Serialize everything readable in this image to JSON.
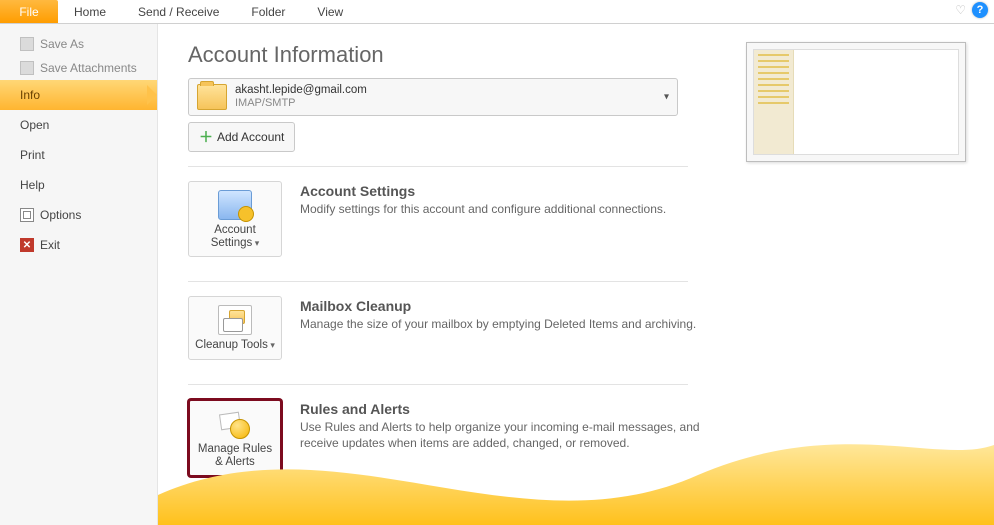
{
  "ribbon": {
    "file_tab": "File",
    "tabs": [
      "Home",
      "Send / Receive",
      "Folder",
      "View"
    ]
  },
  "sidebar": {
    "save_as": "Save As",
    "save_attachments": "Save Attachments",
    "info": "Info",
    "open": "Open",
    "print": "Print",
    "help": "Help",
    "options": "Options",
    "exit": "Exit"
  },
  "page": {
    "title": "Account Information",
    "account_email": "akasht.lepide@gmail.com",
    "account_type": "IMAP/SMTP",
    "add_account": "Add Account"
  },
  "sections": {
    "settings": {
      "btn": "Account Settings",
      "title": "Account Settings",
      "desc": "Modify settings for this account and configure additional connections."
    },
    "cleanup": {
      "btn": "Cleanup Tools",
      "title": "Mailbox Cleanup",
      "desc": "Manage the size of your mailbox by emptying Deleted Items and archiving."
    },
    "rules": {
      "btn": "Manage Rules & Alerts",
      "title": "Rules and Alerts",
      "desc": "Use Rules and Alerts to help organize your incoming e-mail messages, and receive updates when items are added, changed, or removed."
    }
  }
}
